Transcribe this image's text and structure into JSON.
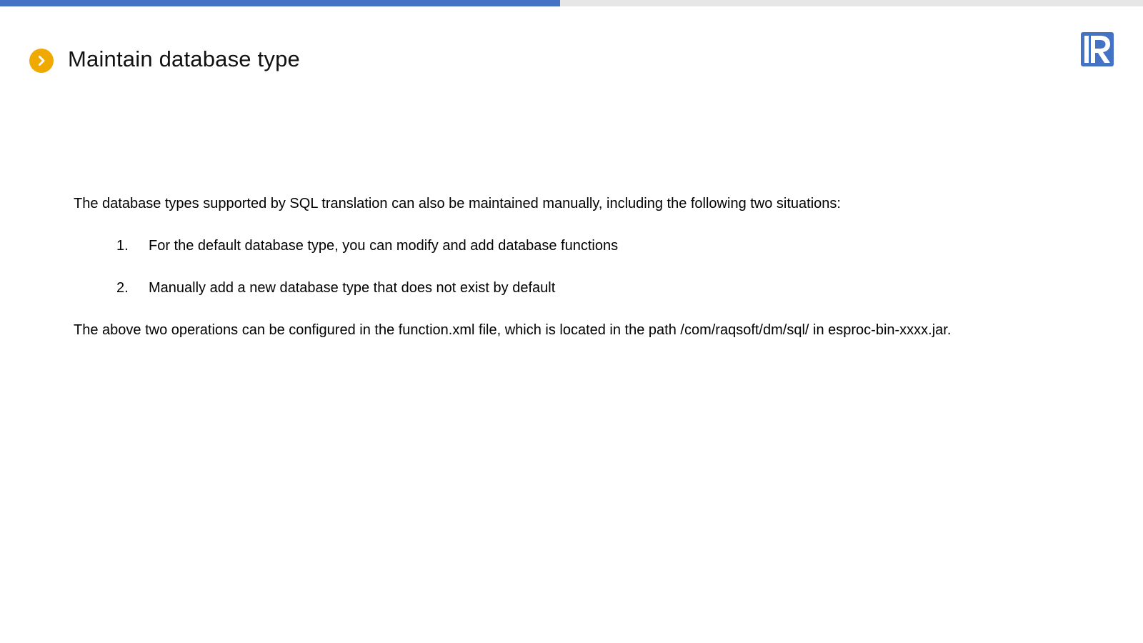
{
  "progress": {
    "fraction": 0.49,
    "fill_color": "#4472c4",
    "track_color": "#e6e6e6"
  },
  "header": {
    "title": "Maintain database type",
    "bullet_icon": "chevron-right-circle-icon",
    "bullet_color": "#f0a900"
  },
  "logo": {
    "icon": "raqsoft-logo",
    "color": "#4472c4"
  },
  "content": {
    "intro": "The database types supported by SQL translation can also be maintained manually, including the following two situations:",
    "items": [
      {
        "number": "1.",
        "text": "For the default database type, you can modify and add database functions"
      },
      {
        "number": "2.",
        "text": "Manually add a new database type that does not exist by default"
      }
    ],
    "conclusion": "The above two operations can be configured in the function.xml file, which is located in the path /com/raqsoft/dm/sql/ in esproc-bin-xxxx.jar."
  }
}
